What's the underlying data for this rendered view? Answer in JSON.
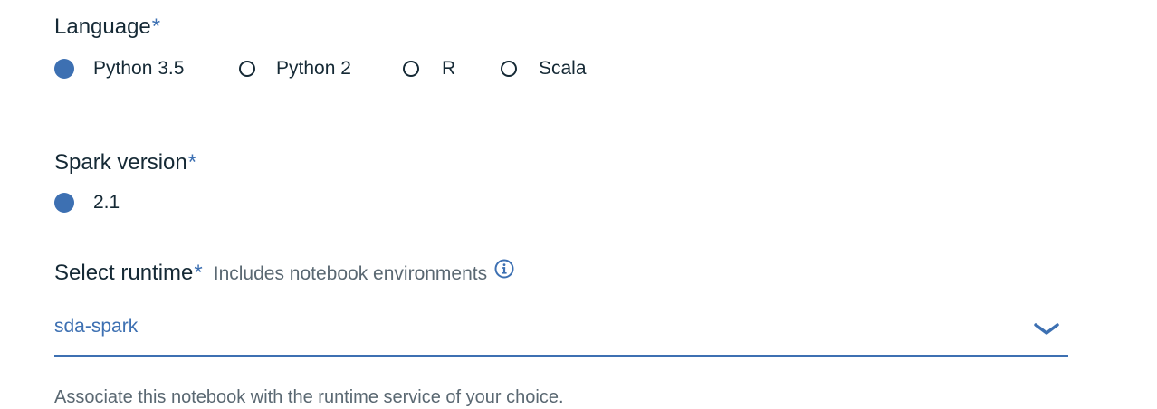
{
  "language": {
    "label": "Language",
    "required_mark": "*",
    "options": [
      {
        "label": "Python 3.5",
        "checked": true
      },
      {
        "label": "Python 2",
        "checked": false
      },
      {
        "label": "R",
        "checked": false
      },
      {
        "label": "Scala",
        "checked": false
      }
    ]
  },
  "spark": {
    "label": "Spark version",
    "required_mark": "*",
    "options": [
      {
        "label": "2.1",
        "checked": true
      }
    ]
  },
  "runtime": {
    "label": "Select runtime",
    "required_mark": "*",
    "hint": "Includes notebook environments",
    "selected_value": "sda-spark",
    "helper_text": "Associate this notebook with the runtime service of your choice."
  },
  "colors": {
    "accent": "#3d70b2",
    "text": "#152935",
    "muted": "#5a6872"
  },
  "icons": {
    "info": "info-circle-icon",
    "chevron": "chevron-down-icon"
  }
}
